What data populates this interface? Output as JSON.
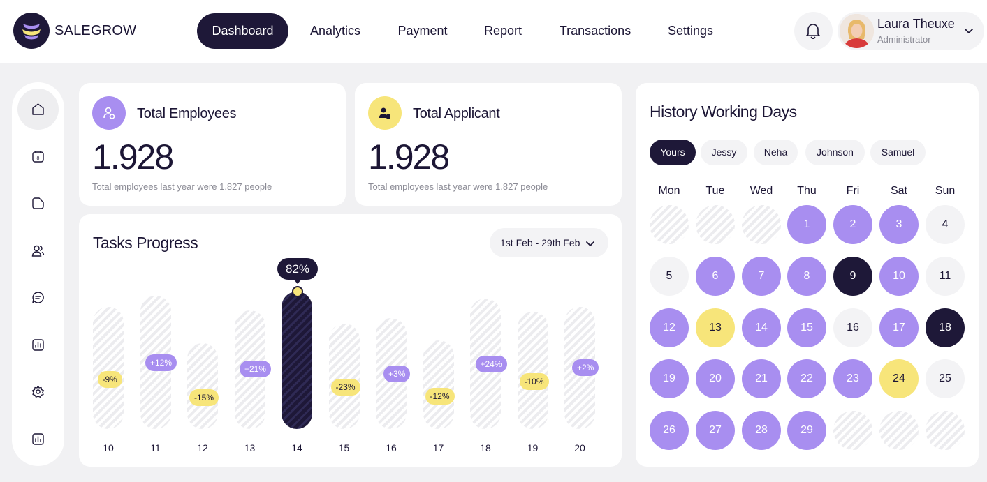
{
  "brand": {
    "name": "SALEGROW"
  },
  "nav": {
    "items": [
      {
        "label": "Dashboard",
        "active": true
      },
      {
        "label": "Analytics",
        "active": false
      },
      {
        "label": "Payment",
        "active": false
      },
      {
        "label": "Report",
        "active": false
      },
      {
        "label": "Transactions",
        "active": false
      },
      {
        "label": "Settings",
        "active": false
      }
    ]
  },
  "user": {
    "name": "Laura Theuxe",
    "role": "Administrator"
  },
  "sidebar": {
    "icons": [
      "home-icon",
      "calendar-icon",
      "folder-icon",
      "users-icon",
      "chat-icon",
      "chart-icon",
      "gear-icon",
      "report-icon"
    ]
  },
  "employees": {
    "title": "Total Employees",
    "value": "1.928",
    "note": "Total employees last year were 1.827 people",
    "icon_color": "#a88ef0"
  },
  "applicants": {
    "title": "Total Applicant",
    "value": "1.928",
    "note": "Total employees last year were 1.827 people",
    "icon_color": "#f7e57a"
  },
  "tasks": {
    "title": "Tasks Progress",
    "date_range": "1st Feb - 29th Feb",
    "highlight": "82%"
  },
  "chart_data": {
    "type": "bar",
    "categories": [
      "10",
      "11",
      "12",
      "13",
      "14",
      "15",
      "16",
      "17",
      "18",
      "19",
      "20"
    ],
    "changes": [
      "-9%",
      "+12%",
      "-15%",
      "+21%",
      "82%",
      "-23%",
      "+3%",
      "-12%",
      "+24%",
      "-10%",
      "+2%"
    ],
    "highlighted_category": "14",
    "highlighted_value": 82
  },
  "calendar": {
    "title": "History Working Days",
    "people": [
      "Yours",
      "Jessy",
      "Neha",
      "Johnson",
      "Samuel"
    ],
    "active_person": "Yours",
    "weekdays": [
      "Mon",
      "Tue",
      "Wed",
      "Thu",
      "Fri",
      "Sat",
      "Sun"
    ],
    "days": [
      {
        "label": "",
        "style": "e"
      },
      {
        "label": "",
        "style": "e"
      },
      {
        "label": "",
        "style": "e"
      },
      {
        "label": "1",
        "style": "p"
      },
      {
        "label": "2",
        "style": "p"
      },
      {
        "label": "3",
        "style": "p"
      },
      {
        "label": "4",
        "style": "g"
      },
      {
        "label": "5",
        "style": "g"
      },
      {
        "label": "6",
        "style": "p"
      },
      {
        "label": "7",
        "style": "p"
      },
      {
        "label": "8",
        "style": "p"
      },
      {
        "label": "9",
        "style": "d"
      },
      {
        "label": "10",
        "style": "p"
      },
      {
        "label": "11",
        "style": "g"
      },
      {
        "label": "12",
        "style": "p"
      },
      {
        "label": "13",
        "style": "y"
      },
      {
        "label": "14",
        "style": "p"
      },
      {
        "label": "15",
        "style": "p"
      },
      {
        "label": "16",
        "style": "g"
      },
      {
        "label": "17",
        "style": "p"
      },
      {
        "label": "18",
        "style": "d"
      },
      {
        "label": "19",
        "style": "p"
      },
      {
        "label": "20",
        "style": "p"
      },
      {
        "label": "21",
        "style": "p"
      },
      {
        "label": "22",
        "style": "p"
      },
      {
        "label": "23",
        "style": "p"
      },
      {
        "label": "24",
        "style": "y"
      },
      {
        "label": "25",
        "style": "g"
      },
      {
        "label": "26",
        "style": "p"
      },
      {
        "label": "27",
        "style": "p"
      },
      {
        "label": "28",
        "style": "p"
      },
      {
        "label": "29",
        "style": "p"
      },
      {
        "label": "",
        "style": "e"
      },
      {
        "label": "",
        "style": "e"
      },
      {
        "label": "",
        "style": "e"
      }
    ]
  },
  "colors": {
    "dark": "#1e1838",
    "purple": "#a88ef0",
    "yellow": "#f7e57a",
    "background": "#f1f1f3"
  }
}
